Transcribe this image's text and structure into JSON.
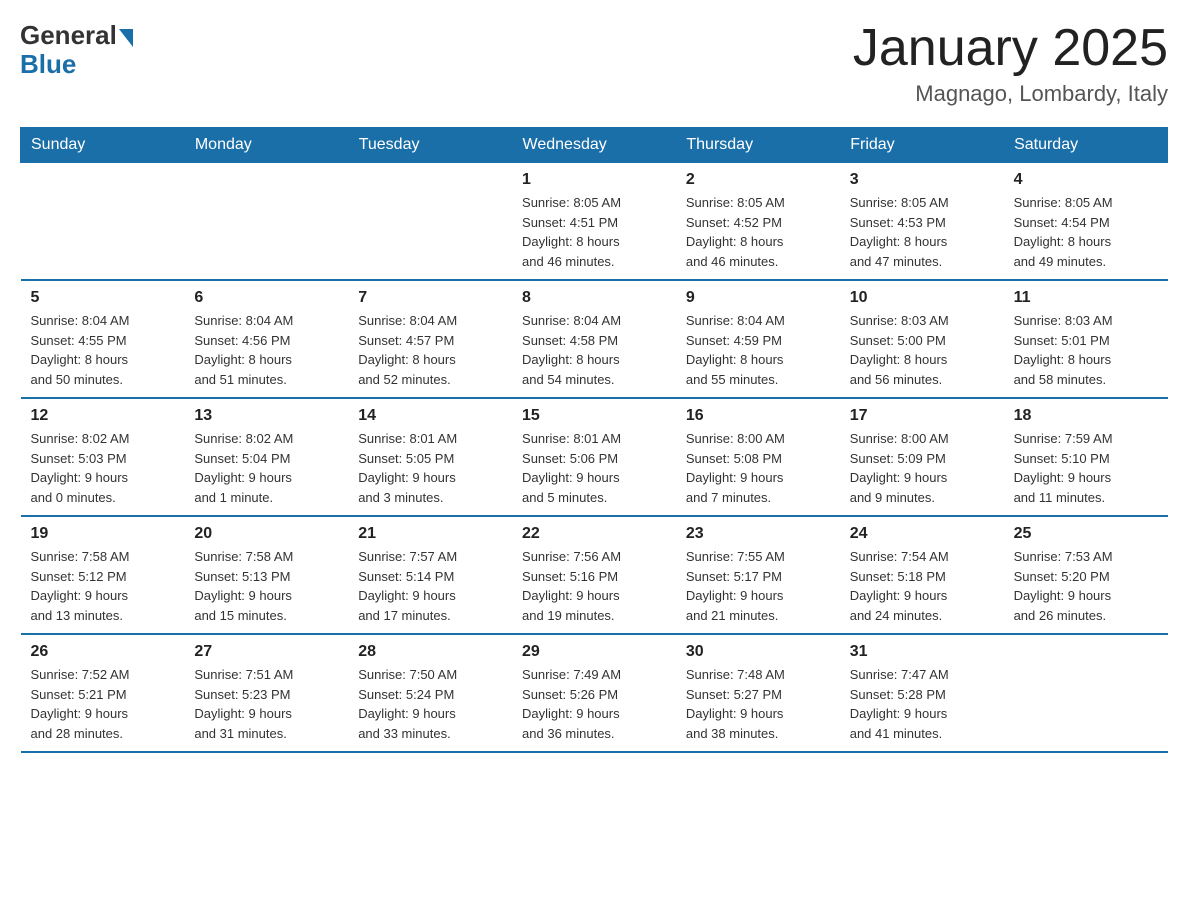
{
  "logo": {
    "general": "General",
    "blue": "Blue"
  },
  "title": "January 2025",
  "location": "Magnago, Lombardy, Italy",
  "weekdays": [
    "Sunday",
    "Monday",
    "Tuesday",
    "Wednesday",
    "Thursday",
    "Friday",
    "Saturday"
  ],
  "weeks": [
    [
      {
        "day": "",
        "info": ""
      },
      {
        "day": "",
        "info": ""
      },
      {
        "day": "",
        "info": ""
      },
      {
        "day": "1",
        "info": "Sunrise: 8:05 AM\nSunset: 4:51 PM\nDaylight: 8 hours\nand 46 minutes."
      },
      {
        "day": "2",
        "info": "Sunrise: 8:05 AM\nSunset: 4:52 PM\nDaylight: 8 hours\nand 46 minutes."
      },
      {
        "day": "3",
        "info": "Sunrise: 8:05 AM\nSunset: 4:53 PM\nDaylight: 8 hours\nand 47 minutes."
      },
      {
        "day": "4",
        "info": "Sunrise: 8:05 AM\nSunset: 4:54 PM\nDaylight: 8 hours\nand 49 minutes."
      }
    ],
    [
      {
        "day": "5",
        "info": "Sunrise: 8:04 AM\nSunset: 4:55 PM\nDaylight: 8 hours\nand 50 minutes."
      },
      {
        "day": "6",
        "info": "Sunrise: 8:04 AM\nSunset: 4:56 PM\nDaylight: 8 hours\nand 51 minutes."
      },
      {
        "day": "7",
        "info": "Sunrise: 8:04 AM\nSunset: 4:57 PM\nDaylight: 8 hours\nand 52 minutes."
      },
      {
        "day": "8",
        "info": "Sunrise: 8:04 AM\nSunset: 4:58 PM\nDaylight: 8 hours\nand 54 minutes."
      },
      {
        "day": "9",
        "info": "Sunrise: 8:04 AM\nSunset: 4:59 PM\nDaylight: 8 hours\nand 55 minutes."
      },
      {
        "day": "10",
        "info": "Sunrise: 8:03 AM\nSunset: 5:00 PM\nDaylight: 8 hours\nand 56 minutes."
      },
      {
        "day": "11",
        "info": "Sunrise: 8:03 AM\nSunset: 5:01 PM\nDaylight: 8 hours\nand 58 minutes."
      }
    ],
    [
      {
        "day": "12",
        "info": "Sunrise: 8:02 AM\nSunset: 5:03 PM\nDaylight: 9 hours\nand 0 minutes."
      },
      {
        "day": "13",
        "info": "Sunrise: 8:02 AM\nSunset: 5:04 PM\nDaylight: 9 hours\nand 1 minute."
      },
      {
        "day": "14",
        "info": "Sunrise: 8:01 AM\nSunset: 5:05 PM\nDaylight: 9 hours\nand 3 minutes."
      },
      {
        "day": "15",
        "info": "Sunrise: 8:01 AM\nSunset: 5:06 PM\nDaylight: 9 hours\nand 5 minutes."
      },
      {
        "day": "16",
        "info": "Sunrise: 8:00 AM\nSunset: 5:08 PM\nDaylight: 9 hours\nand 7 minutes."
      },
      {
        "day": "17",
        "info": "Sunrise: 8:00 AM\nSunset: 5:09 PM\nDaylight: 9 hours\nand 9 minutes."
      },
      {
        "day": "18",
        "info": "Sunrise: 7:59 AM\nSunset: 5:10 PM\nDaylight: 9 hours\nand 11 minutes."
      }
    ],
    [
      {
        "day": "19",
        "info": "Sunrise: 7:58 AM\nSunset: 5:12 PM\nDaylight: 9 hours\nand 13 minutes."
      },
      {
        "day": "20",
        "info": "Sunrise: 7:58 AM\nSunset: 5:13 PM\nDaylight: 9 hours\nand 15 minutes."
      },
      {
        "day": "21",
        "info": "Sunrise: 7:57 AM\nSunset: 5:14 PM\nDaylight: 9 hours\nand 17 minutes."
      },
      {
        "day": "22",
        "info": "Sunrise: 7:56 AM\nSunset: 5:16 PM\nDaylight: 9 hours\nand 19 minutes."
      },
      {
        "day": "23",
        "info": "Sunrise: 7:55 AM\nSunset: 5:17 PM\nDaylight: 9 hours\nand 21 minutes."
      },
      {
        "day": "24",
        "info": "Sunrise: 7:54 AM\nSunset: 5:18 PM\nDaylight: 9 hours\nand 24 minutes."
      },
      {
        "day": "25",
        "info": "Sunrise: 7:53 AM\nSunset: 5:20 PM\nDaylight: 9 hours\nand 26 minutes."
      }
    ],
    [
      {
        "day": "26",
        "info": "Sunrise: 7:52 AM\nSunset: 5:21 PM\nDaylight: 9 hours\nand 28 minutes."
      },
      {
        "day": "27",
        "info": "Sunrise: 7:51 AM\nSunset: 5:23 PM\nDaylight: 9 hours\nand 31 minutes."
      },
      {
        "day": "28",
        "info": "Sunrise: 7:50 AM\nSunset: 5:24 PM\nDaylight: 9 hours\nand 33 minutes."
      },
      {
        "day": "29",
        "info": "Sunrise: 7:49 AM\nSunset: 5:26 PM\nDaylight: 9 hours\nand 36 minutes."
      },
      {
        "day": "30",
        "info": "Sunrise: 7:48 AM\nSunset: 5:27 PM\nDaylight: 9 hours\nand 38 minutes."
      },
      {
        "day": "31",
        "info": "Sunrise: 7:47 AM\nSunset: 5:28 PM\nDaylight: 9 hours\nand 41 minutes."
      },
      {
        "day": "",
        "info": ""
      }
    ]
  ]
}
